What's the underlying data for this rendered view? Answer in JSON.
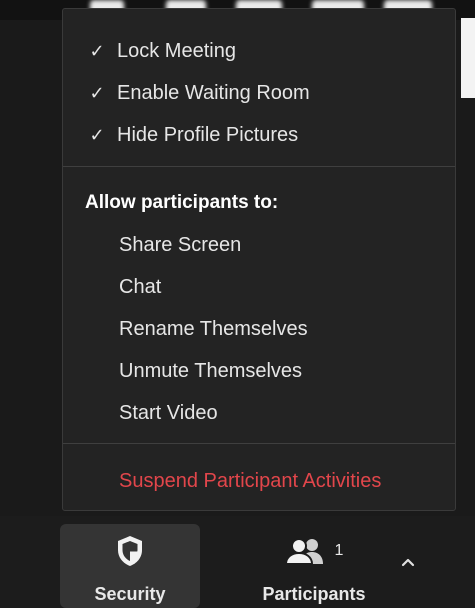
{
  "menu": {
    "toggles": [
      {
        "label": "Lock Meeting",
        "checked": true
      },
      {
        "label": "Enable Waiting Room",
        "checked": true
      },
      {
        "label": "Hide Profile Pictures",
        "checked": true
      }
    ],
    "allow_title": "Allow participants to:",
    "allow_items": [
      {
        "label": "Share Screen"
      },
      {
        "label": "Chat"
      },
      {
        "label": "Rename Themselves"
      },
      {
        "label": "Unmute Themselves"
      },
      {
        "label": "Start Video"
      }
    ],
    "suspend_label": "Suspend Participant Activities",
    "check_glyph": "✓"
  },
  "toolbar": {
    "security": {
      "label": "Security",
      "icon": "shield-icon"
    },
    "participants": {
      "label": "Participants",
      "icon": "people-icon",
      "count": "1"
    },
    "caret_icon": "chevron-up-icon"
  },
  "colors": {
    "danger": "#e2464b",
    "menu_bg": "#232323",
    "toolbar_bg": "#1c1c1c",
    "active_bg": "#343434"
  }
}
